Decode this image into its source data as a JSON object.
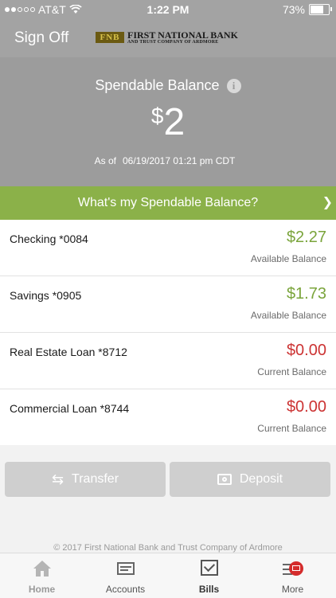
{
  "status_bar": {
    "carrier": "AT&T",
    "time": "1:22 PM",
    "battery": "73%",
    "battery_level": 0.73,
    "signal_bars": 2
  },
  "header": {
    "sign_off": "Sign Off",
    "logo_mark": "FNB",
    "logo_line1": "FIRST NATIONAL BANK",
    "logo_line2": "AND TRUST COMPANY OF ARDMORE"
  },
  "balance": {
    "title": "Spendable Balance",
    "info_glyph": "i",
    "currency": "$",
    "amount": "2",
    "as_of_label": "As of",
    "as_of_date": "06/19/2017 01:21 pm CDT"
  },
  "promo": {
    "label": "What's my Spendable Balance?",
    "chevron": "❯"
  },
  "accounts": [
    {
      "name": "Checking *0084",
      "amount": "$2.27",
      "sub": "Available Balance",
      "status": "positive"
    },
    {
      "name": "Savings *0905",
      "amount": "$1.73",
      "sub": "Available Balance",
      "status": "positive"
    },
    {
      "name": "Real Estate Loan *8712",
      "amount": "$0.00",
      "sub": "Current Balance",
      "status": "negative"
    },
    {
      "name": "Commercial Loan *8744",
      "amount": "$0.00",
      "sub": "Current Balance",
      "status": "negative"
    }
  ],
  "actions": {
    "transfer": "Transfer",
    "transfer_icon": "⇆",
    "deposit": "Deposit"
  },
  "footer": {
    "copyright": "© 2017 First National Bank and Trust Company of Ardmore"
  },
  "tabs": {
    "home": "Home",
    "accounts": "Accounts",
    "bills": "Bills",
    "more": "More"
  },
  "colors": {
    "header_gray": "#a3a3a3",
    "hero_gray": "#9c9c9c",
    "promo_green": "#8bb149",
    "positive": "#7aa43b",
    "negative": "#cc3333",
    "badge_red": "#d42c2c"
  },
  "icons": [
    "wifi-icon",
    "battery-icon",
    "info-icon",
    "chevron-right-icon",
    "transfer-arrows-icon",
    "camera-icon",
    "home-icon",
    "accounts-icon",
    "bills-icon",
    "more-icon"
  ]
}
